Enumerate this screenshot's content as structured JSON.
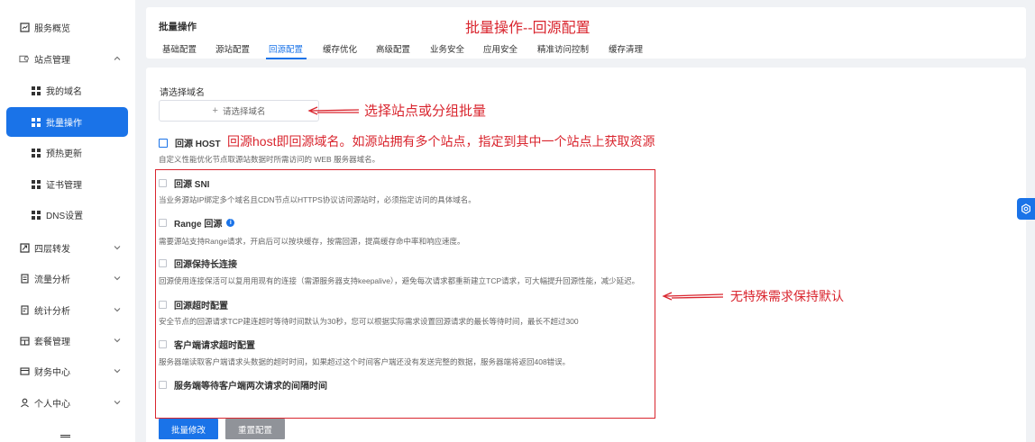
{
  "sidebar": {
    "items": [
      {
        "label": "服务概览",
        "icon": "chart-icon"
      },
      {
        "label": "站点管理",
        "icon": "globe-icon",
        "expanded": true
      },
      {
        "label": "四层转发",
        "icon": "forward-icon"
      },
      {
        "label": "流量分析",
        "icon": "document-icon"
      },
      {
        "label": "统计分析",
        "icon": "stats-icon"
      },
      {
        "label": "套餐管理",
        "icon": "package-icon"
      },
      {
        "label": "财务中心",
        "icon": "wallet-icon"
      },
      {
        "label": "个人中心",
        "icon": "user-icon"
      }
    ],
    "sub_items": [
      {
        "label": "我的域名"
      },
      {
        "label": "批量操作",
        "active": true
      },
      {
        "label": "预热更新"
      },
      {
        "label": "证书管理"
      },
      {
        "label": "DNS设置"
      }
    ]
  },
  "header": {
    "title": "批量操作",
    "tabs": [
      "基础配置",
      "源站配置",
      "回源配置",
      "缓存优化",
      "高级配置",
      "业务安全",
      "应用安全",
      "精准访问控制",
      "缓存清理"
    ],
    "active_tab": "回源配置"
  },
  "form": {
    "domain_label": "请选择域名",
    "domain_placeholder": "请选择域名",
    "host_option": {
      "label": "回源 HOST",
      "desc": "自定义性能优化节点取源站数据时所需访问的 WEB 服务器域名。"
    },
    "options": [
      {
        "label": "回源 SNI",
        "desc": "当业务源站IP绑定多个域名且CDN节点以HTTPS协议访问源站时，必须指定访问的具体域名。"
      },
      {
        "label": "Range 回源",
        "desc": "需要源站支持Range请求，开启后可以按块缓存，按需回源，提高缓存命中率和响应速度。",
        "info": true
      },
      {
        "label": "回源保持长连接",
        "desc": "回源使用连接保活可以复用用现有的连接（需源服务器支持keepalive），避免每次请求都重新建立TCP请求，可大幅提升回源性能，减少延迟。"
      },
      {
        "label": "回源超时配置",
        "desc": "安全节点的回源请求TCP建连超时等待时间默认为30秒，您可以根据实际需求设置回源请求的最长等待时间，最长不超过300"
      },
      {
        "label": "客户端请求超时配置",
        "desc": "服务器端读取客户端请求头数据的超时时间，如果超过这个时间客户端还没有发送完整的数据，服务器端将返回408错误。"
      },
      {
        "label": "服务端等待客户端两次请求的间隔时间",
        "desc": ""
      }
    ],
    "submit_label": "批量修改",
    "reset_label": "重置配置"
  },
  "annotations": {
    "title": "批量操作--回源配置",
    "select": "选择站点或分组批量",
    "host": "回源host即回源域名。如源站拥有多个站点，指定到其中一个站点上获取资源",
    "default": "无特殊需求保持默认"
  },
  "colors": {
    "primary": "#1a73e8",
    "annotation": "#d9252e",
    "secondary_button": "#909399"
  }
}
